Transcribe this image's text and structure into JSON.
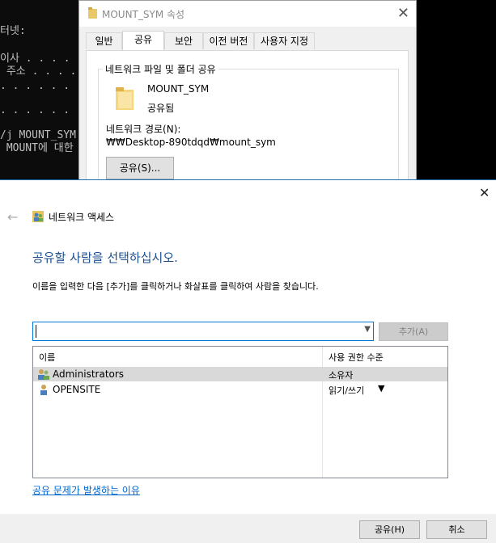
{
  "console": {
    "lines": [
      "터넷:",
      "이사 . . . . :",
      " 주소 . . . . :",
      ". . . . . . . :",
      ". . . . . . . :",
      "/j MOUNT_SYM",
      " MOUNT에 대한"
    ]
  },
  "properties_window": {
    "title": "MOUNT_SYM 속성",
    "tabs": [
      "일반",
      "공유",
      "보안",
      "이전 버전",
      "사용자 지정"
    ],
    "active_tab": "공유",
    "group_title": "네트워크 파일 및 폴더 공유",
    "share_name": "MOUNT_SYM",
    "share_state": "공유됨",
    "network_path_label": "네트워크 경로(N):",
    "network_path": "₩₩Desktop-890tdqd₩mount_sym",
    "share_button": "공유(S)..."
  },
  "dialog": {
    "breadcrumb_title": "네트워크 액세스",
    "heading": "공유할 사람을 선택하십시오.",
    "instruction": "이름을 입력한 다음 [추가]를 클릭하거나 화살표를 클릭하여 사람을 찾습니다.",
    "name_input_value": "",
    "add_button": "추가(A)",
    "table": {
      "columns": [
        "이름",
        "사용 권한 수준"
      ],
      "rows": [
        {
          "name": "Administrators",
          "permission": "소유자",
          "selected": true
        },
        {
          "name": "OPENSITE",
          "permission": "읽기/쓰기",
          "has_dropdown": true,
          "selected": false
        }
      ]
    },
    "help_link": "공유 문제가 발생하는 이유",
    "share_button": "공유(H)",
    "cancel_button": "취소"
  },
  "colors": {
    "accent": "#0078d7",
    "heading": "#1e4e8c",
    "link": "#0066cc",
    "selected_row": "#d9d9d9"
  }
}
